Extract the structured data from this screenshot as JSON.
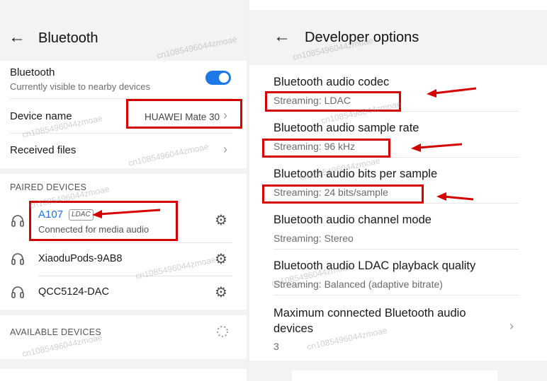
{
  "left": {
    "title": "Bluetooth",
    "bluetooth": {
      "label": "Bluetooth",
      "sub": "Currently visible to nearby devices",
      "enabled": true
    },
    "device_name": {
      "label": "Device name",
      "value": "HUAWEI Mate 30"
    },
    "received_files": {
      "label": "Received files"
    },
    "paired_header": "PAIRED DEVICES",
    "paired": [
      {
        "name": "A107",
        "badge": "LDAC",
        "status": "Connected for media audio"
      },
      {
        "name": "XiaoduPods-9AB8"
      },
      {
        "name": "QCC5124-DAC"
      }
    ],
    "available_header": "AVAILABLE DEVICES"
  },
  "right": {
    "title": "Developer options",
    "options": [
      {
        "title": "Bluetooth audio codec",
        "sub": "Streaming: LDAC"
      },
      {
        "title": "Bluetooth audio sample rate",
        "sub": "Streaming: 96 kHz"
      },
      {
        "title": "Bluetooth audio bits per sample",
        "sub": "Streaming: 24 bits/sample"
      },
      {
        "title": "Bluetooth audio channel mode",
        "sub": "Streaming: Stereo"
      },
      {
        "title": "Bluetooth audio LDAC playback quality",
        "sub": "Streaming: Balanced (adaptive bitrate)"
      },
      {
        "title": "Maximum connected Bluetooth audio devices",
        "sub": "3"
      }
    ]
  },
  "watermark": "cn1085496044zmoae",
  "colors": {
    "accent": "#1e78e6",
    "highlight": "#d40000",
    "link": "#1a73e8"
  }
}
